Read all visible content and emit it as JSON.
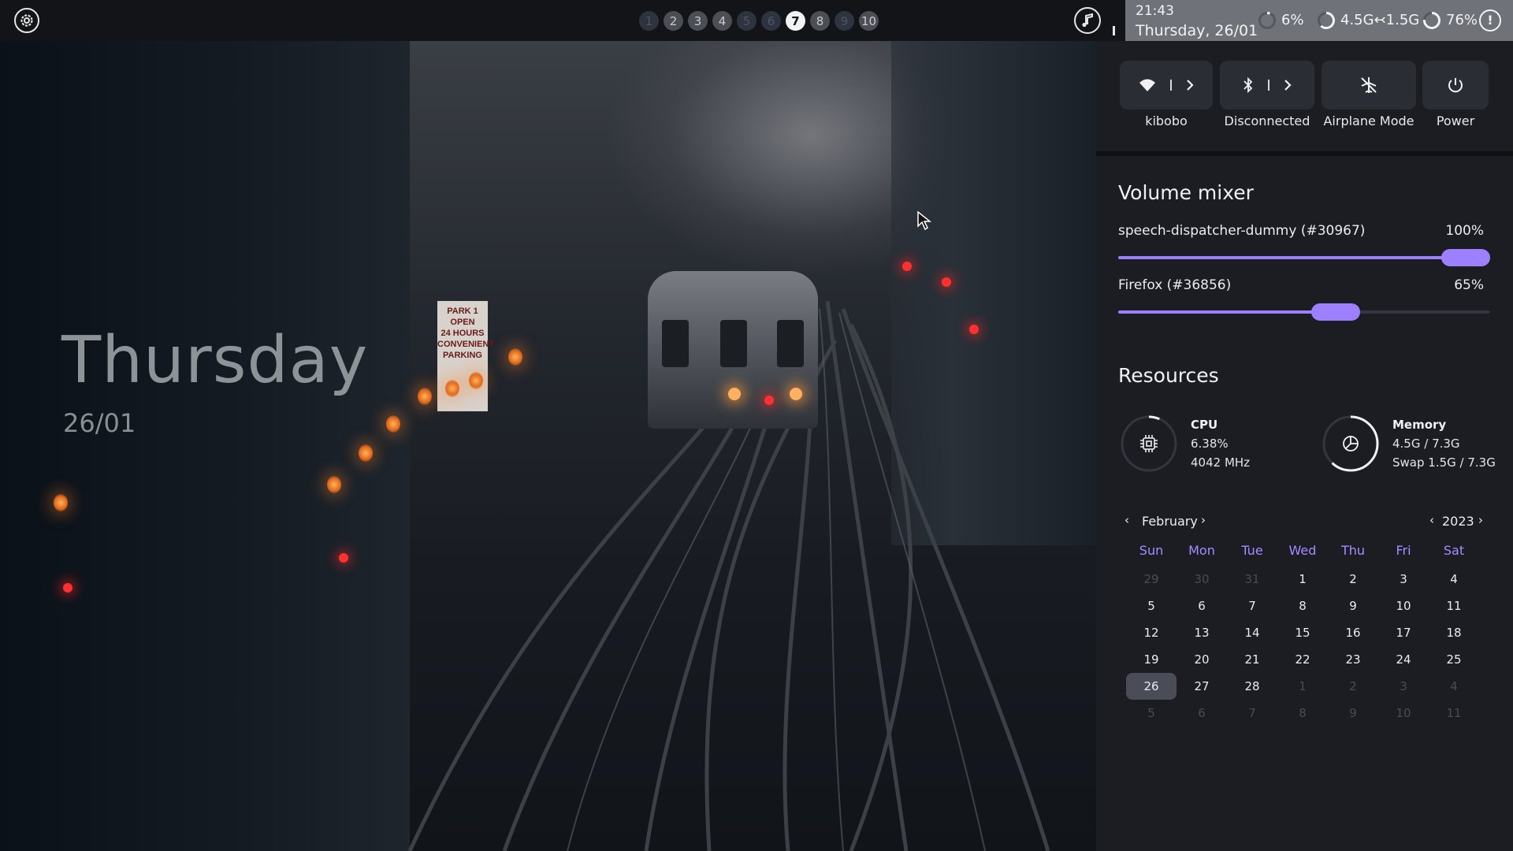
{
  "desktop": {
    "day": "Thursday",
    "date": "26/01"
  },
  "topbar": {
    "workspaces": [
      "1",
      "2",
      "3",
      "4",
      "5",
      "6",
      "7",
      "8",
      "9",
      "10"
    ],
    "active_workspace": "7",
    "clock_time": "21:43",
    "clock_date": "Thursday, 26/01",
    "cpu_text": "6%",
    "cpu_fraction": 0.06,
    "memory_text": "4.5G↢1.5G",
    "memory_fraction": 0.62,
    "battery_text": "76%",
    "battery_fraction": 0.76,
    "notification_icon": "!"
  },
  "wallpaper_sign": [
    "PARK 1",
    "OPEN",
    "24 HOURS",
    "CONVENIENT",
    "PARKING"
  ],
  "quick_settings": {
    "wifi": {
      "label": "kibobo",
      "icon": "wifi-icon"
    },
    "bluetooth": {
      "label": "Disconnected",
      "icon": "bluetooth-icon"
    },
    "airplane": {
      "label": "Airplane Mode",
      "icon": "airplane-off-icon"
    },
    "power": {
      "label": "Power",
      "icon": "power-icon"
    }
  },
  "volume_mixer": {
    "title": "Volume mixer",
    "streams": [
      {
        "name": "speech-dispatcher-dummy (#30967)",
        "percent": "100%",
        "level": 1.0
      },
      {
        "name": "Firefox (#36856)",
        "percent": "65%",
        "level": 0.65
      }
    ]
  },
  "resources": {
    "title": "Resources",
    "cpu": {
      "title": "CPU",
      "usage": "6.38%",
      "freq": "4042 MHz",
      "fraction": 0.0638
    },
    "memory": {
      "title": "Memory",
      "usage": "4.5G / 7.3G",
      "swap": "Swap 1.5G / 7.3G",
      "fraction": 0.62
    }
  },
  "calendar": {
    "month": "February",
    "year": "2023",
    "weekdays": [
      "Sun",
      "Mon",
      "Tue",
      "Wed",
      "Thu",
      "Fri",
      "Sat"
    ],
    "weeks": [
      [
        {
          "d": "29",
          "o": true
        },
        {
          "d": "30",
          "o": true
        },
        {
          "d": "31",
          "o": true
        },
        {
          "d": "1"
        },
        {
          "d": "2"
        },
        {
          "d": "3"
        },
        {
          "d": "4"
        }
      ],
      [
        {
          "d": "5"
        },
        {
          "d": "6"
        },
        {
          "d": "7"
        },
        {
          "d": "8"
        },
        {
          "d": "9"
        },
        {
          "d": "10"
        },
        {
          "d": "11"
        }
      ],
      [
        {
          "d": "12"
        },
        {
          "d": "13"
        },
        {
          "d": "14"
        },
        {
          "d": "15"
        },
        {
          "d": "16"
        },
        {
          "d": "17"
        },
        {
          "d": "18"
        }
      ],
      [
        {
          "d": "19"
        },
        {
          "d": "20"
        },
        {
          "d": "21"
        },
        {
          "d": "22"
        },
        {
          "d": "23"
        },
        {
          "d": "24"
        },
        {
          "d": "25"
        }
      ],
      [
        {
          "d": "26",
          "today": true
        },
        {
          "d": "27"
        },
        {
          "d": "28"
        },
        {
          "d": "1",
          "o": true
        },
        {
          "d": "2",
          "o": true
        },
        {
          "d": "3",
          "o": true
        },
        {
          "d": "4",
          "o": true
        }
      ],
      [
        {
          "d": "5",
          "o": true
        },
        {
          "d": "6",
          "o": true
        },
        {
          "d": "7",
          "o": true
        },
        {
          "d": "8",
          "o": true
        },
        {
          "d": "9",
          "o": true
        },
        {
          "d": "10",
          "o": true
        },
        {
          "d": "11",
          "o": true
        }
      ]
    ]
  },
  "colors": {
    "accent": "#9c80ff",
    "bar": "#121418",
    "status_pill": "#6f7278",
    "sidebar": "#1c1d23"
  }
}
